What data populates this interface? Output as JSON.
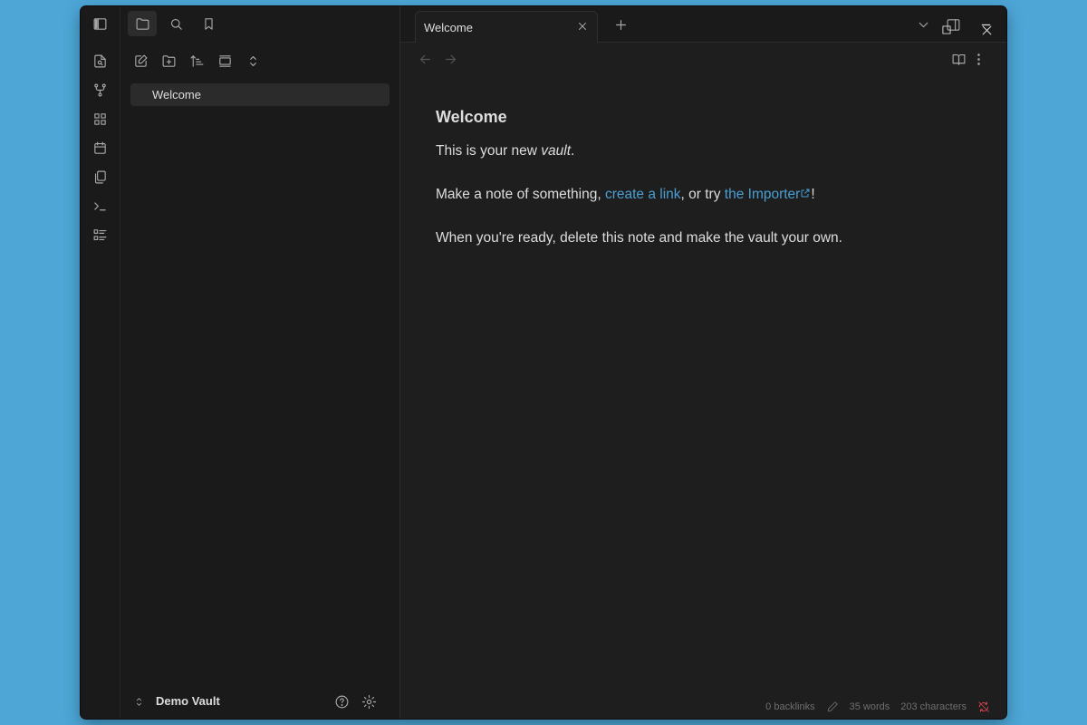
{
  "sidebar": {
    "files": [
      {
        "label": "Welcome"
      }
    ],
    "vault_name": "Demo Vault"
  },
  "tabs": [
    {
      "label": "Welcome"
    }
  ],
  "document": {
    "title": "Welcome",
    "p1_prefix": "This is your new ",
    "p1_em": "vault",
    "p1_suffix": ".",
    "p2_prefix": "Make a note of something, ",
    "p2_link1": "create a link",
    "p2_mid": ", or try ",
    "p2_link2": "the Importer",
    "p2_suffix": "!",
    "p3": "When you're ready, delete this note and make the vault your own."
  },
  "status": {
    "backlinks": "0 backlinks",
    "words": "35 words",
    "characters": "203 characters"
  },
  "colors": {
    "desktop": "#4da6d6",
    "accent_link": "#4a9fd4",
    "sync_error": "#e0454f"
  }
}
